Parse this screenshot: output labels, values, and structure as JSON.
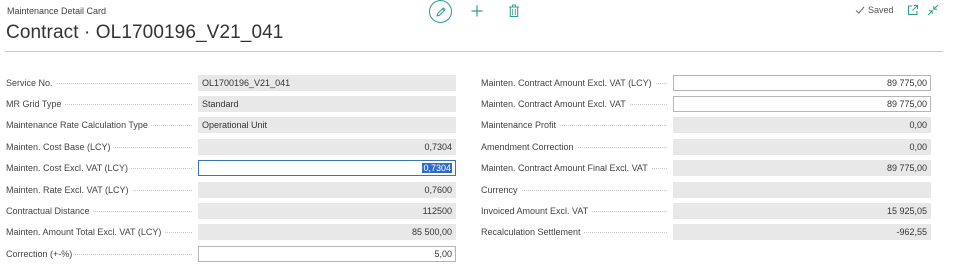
{
  "header": {
    "caption": "Maintenance Detail Card",
    "title": "Contract · OL1700196_V21_041",
    "status": "Saved"
  },
  "icons": {
    "edit": "pencil-icon",
    "add": "plus-icon",
    "delete": "trash-icon",
    "saved": "checkmark-icon",
    "popout": "open-in-new-window-icon",
    "collapse": "collapse-icon"
  },
  "colors": {
    "accent": "#2a9d8f",
    "selection": "#2f6ccc",
    "readonly_field": "#e8e8e8"
  },
  "left_fields": [
    {
      "label": "Service No.",
      "value": "OL1700196_V21_041"
    },
    {
      "label": "MR Grid Type",
      "value": "Standard"
    },
    {
      "label": "Maintenance Rate Calculation Type",
      "value": "Operational Unit"
    },
    {
      "label": "Mainten. Cost Base (LCY)",
      "value": "0,7304"
    },
    {
      "label": "Mainten. Cost Excl. VAT (LCY)",
      "value": "0,7304"
    },
    {
      "label": "Mainten. Rate Excl. VAT (LCY)",
      "value": "0,7600"
    },
    {
      "label": "Contractual Distance",
      "value": "112500"
    },
    {
      "label": "Mainten. Amount Total Excl. VAT (LCY)",
      "value": "85 500,00"
    },
    {
      "label": "Correction (+-%)",
      "value": "5,00"
    }
  ],
  "right_fields": [
    {
      "label": "Mainten. Contract Amount Excl. VAT (LCY)",
      "value": "89 775,00"
    },
    {
      "label": "Mainten. Contract Amount Excl. VAT",
      "value": "89 775,00"
    },
    {
      "label": "Maintenance Profit",
      "value": "0,00"
    },
    {
      "label": "Amendment Correction",
      "value": "0,00"
    },
    {
      "label": "Mainten. Contract Amount Final Excl. VAT",
      "value": "89 775,00"
    },
    {
      "label": "Currency",
      "value": ""
    },
    {
      "label": "Invoiced Amount Excl. VAT",
      "value": "15 925,05"
    },
    {
      "label": "Recalculation Settlement",
      "value": "-962,55"
    }
  ]
}
